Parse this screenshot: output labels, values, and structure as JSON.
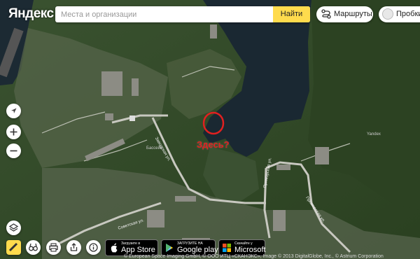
{
  "brand": {
    "logo": "Яндекс"
  },
  "search": {
    "placeholder": "Места и организации",
    "button": "Найти"
  },
  "header": {
    "routes_label": "Маршруты",
    "traffic_label": "Пробки"
  },
  "controls": {
    "locate_icon": "location-arrow-icon",
    "zoom_in_icon": "plus-icon",
    "zoom_out_icon": "minus-icon",
    "layers_icon": "layers-icon",
    "ruler_icon": "ruler-icon",
    "panorama_icon": "binoculars-icon",
    "print_icon": "printer-icon",
    "share_icon": "share-icon",
    "info_icon": "info-icon"
  },
  "stores": {
    "appstore_small": "Загрузите в",
    "appstore_big": "App Store",
    "googleplay_small": "ЗАГРУЗИТЕ НА",
    "googleplay_big": "Google play",
    "microsoft_small": "Скачайте у",
    "microsoft_big": "Microsoft"
  },
  "map": {
    "annotation_text": "Здесь?",
    "annotation_color": "#e02020",
    "street_1": "Заводская ул.",
    "street_2": "Советская ул.",
    "street_3": "Приморская ул.",
    "street_4": "Приморская ул.",
    "place_label": "Yandex",
    "feature_label": "Бассейн",
    "attribution": "© European Space Imaging GmbH, © ООО ИТЦ «СКАНЭКС», Image © 2013 DigitalGlobe, Inc., © Astrium Corporation"
  },
  "colors": {
    "accent": "#ffdb4d",
    "water": "#1c2a34",
    "forest": "#2f4a24"
  }
}
